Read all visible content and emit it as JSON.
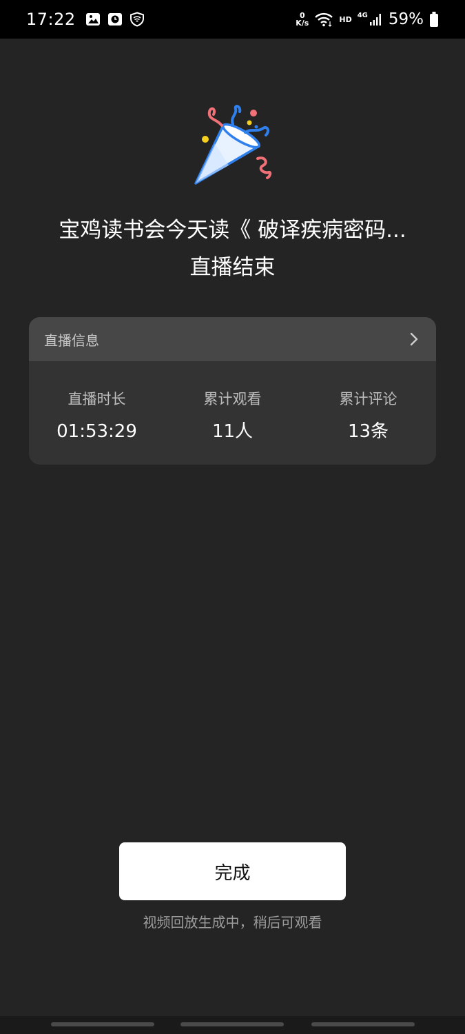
{
  "status_bar": {
    "time": "17:22",
    "net_speed_value": "0",
    "net_speed_unit": "K/s",
    "hd_label": "HD",
    "network_type": "4G",
    "battery_percent": "59%",
    "icons": [
      "gallery-icon",
      "clock-app-icon",
      "shield-icon",
      "wifi-icon",
      "signal-icon",
      "battery-icon"
    ]
  },
  "header": {
    "icon": "party-popper-icon",
    "title": "宝鸡读书会今天读《 破译疾病密码...",
    "subtitle": "直播结束"
  },
  "card": {
    "header_label": "直播信息",
    "stats": [
      {
        "label": "直播时长",
        "value": "01:53:29"
      },
      {
        "label": "累计观看",
        "value": "11人"
      },
      {
        "label": "累计评论",
        "value": "13条"
      }
    ]
  },
  "footer": {
    "done_label": "完成",
    "hint": "视频回放生成中，稍后可观看"
  },
  "colors": {
    "background": "#242424",
    "card_bg": "#333333",
    "card_header_bg": "#474747",
    "button_bg": "#ffffff",
    "accent_blue": "#2f80ed",
    "accent_pink": "#f07178",
    "accent_yellow": "#f5d020"
  }
}
